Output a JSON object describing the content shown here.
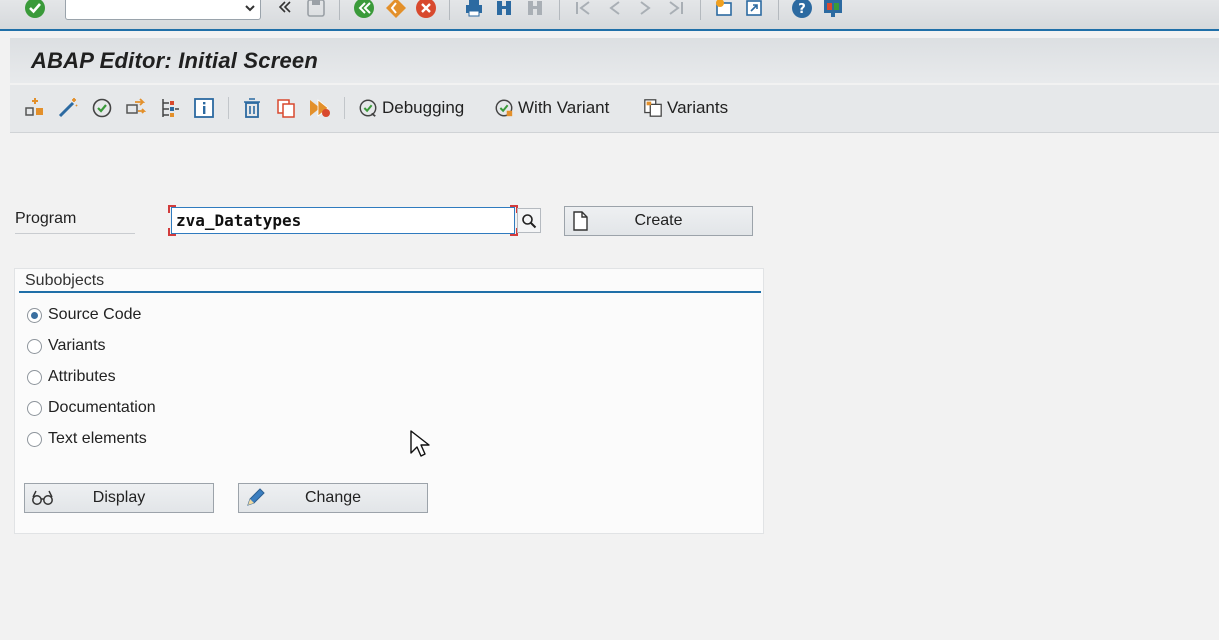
{
  "window": {
    "title": "ABAP Editor: Initial Screen"
  },
  "colors": {
    "accent": "#1f6fa8",
    "required_marker": "#d23c3c",
    "enter_green": "#3a9a3a"
  },
  "system_toolbar": {
    "command_field_value": "",
    "icons": [
      "enter-check-icon",
      "command-dropdown-icon",
      "collapse-icon",
      "save-icon",
      "back-icon",
      "exit-icon",
      "cancel-icon",
      "print-icon",
      "find-icon",
      "find-next-icon",
      "first-page-icon",
      "previous-page-icon",
      "next-page-icon",
      "last-page-icon",
      "new-session-icon",
      "shortcut-icon",
      "help-icon",
      "customize-layout-icon"
    ]
  },
  "app_toolbar": {
    "icons": [
      "other-object-icon",
      "wizard-icon",
      "check-icon",
      "activate-icon",
      "where-used-icon",
      "info-icon",
      "delete-icon",
      "copy-icon",
      "execute-icon"
    ],
    "debugging_label": "Debugging",
    "with_variant_label": "With Variant",
    "variants_label": "Variants"
  },
  "program": {
    "label": "Program",
    "value": "zva_Datatypes",
    "create_label": "Create"
  },
  "subobjects": {
    "title": "Subobjects",
    "options": [
      {
        "label": "Source Code",
        "selected": true
      },
      {
        "label": "Variants",
        "selected": false
      },
      {
        "label": "Attributes",
        "selected": false
      },
      {
        "label": "Documentation",
        "selected": false
      },
      {
        "label": "Text elements",
        "selected": false
      }
    ],
    "display_label": "Display",
    "change_label": "Change"
  }
}
